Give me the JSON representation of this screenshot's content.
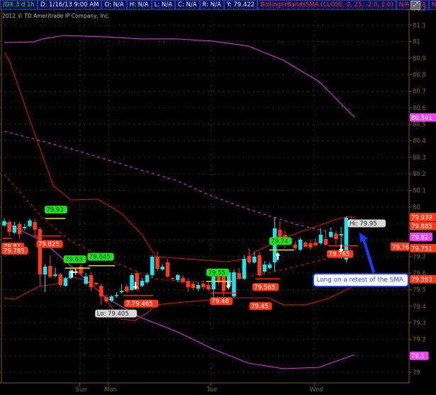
{
  "header": {
    "symbol": "/DX 3 d 1h",
    "date": "D: 1/16/13 9:00 AM",
    "open": "O: N/A",
    "high": "H: N/A",
    "low": "L: N/A",
    "close": "C: N/A",
    "range": "R: N/A",
    "y_value": "Y: 79.422",
    "study": "BollingerBandsSMA (CLOSE, 0, 25, -2.0, 2.0)",
    "study_v1": "N/A",
    "study_v2": "N/A",
    "study_v3": "N...",
    "scale_icon": "autoscale-icon"
  },
  "copyright": "2012 © TD Ameritrade IP Company, Inc.",
  "callout": "Long on a retest of the SMA.",
  "colors": {
    "up": "#22e0e8",
    "down": "#ff3a1a",
    "band": "#c81e0a",
    "outer": "#d23ad6",
    "grid": "#6a5020",
    "axis": "#7a5a20",
    "green_label": "#22dd22",
    "red_label": "#ff3a1a",
    "magenta_label": "#ee44ee",
    "callout_border": "#1a3cff"
  },
  "chart_data": {
    "type": "candlestick",
    "title": "/DX 3 d 1h",
    "ylim": [
      79.0,
      81.2
    ],
    "y_ticks": [
      "81.2",
      "81.1",
      "81",
      "80.9",
      "80.8",
      "80.7",
      "80.6",
      "80.5",
      "80.4",
      "80.3",
      "80.2",
      "80.1",
      "80",
      "79.9",
      "79.8",
      "79.7",
      "79.6",
      "79.5",
      "79.4",
      "79.3",
      "79.2",
      "79.1",
      "79"
    ],
    "x_ticks": [
      {
        "label": "Sun",
        "bar": 14.8
      },
      {
        "label": "Mon",
        "bar": 20.4
      },
      {
        "label": "Tue",
        "bar": 40.5
      },
      {
        "label": "Wed",
        "bar": 60.7
      }
    ],
    "candles": [
      [
        79.888,
        79.931,
        79.879,
        79.914
      ],
      [
        79.909,
        79.922,
        79.823,
        79.849
      ],
      [
        79.845,
        79.909,
        79.836,
        79.888
      ],
      [
        79.896,
        79.909,
        79.806,
        79.836
      ],
      [
        79.871,
        79.896,
        79.858,
        79.879
      ],
      [
        79.884,
        79.931,
        79.875,
        79.918
      ],
      [
        79.909,
        79.931,
        79.815,
        79.862
      ],
      [
        79.866,
        79.879,
        79.523,
        79.592
      ],
      [
        79.592,
        79.656,
        79.485,
        79.639
      ],
      [
        79.643,
        79.708,
        79.57,
        79.579
      ],
      [
        79.583,
        79.635,
        79.575,
        79.592
      ],
      [
        79.592,
        79.6,
        79.515,
        79.528
      ],
      [
        79.523,
        79.579,
        79.519,
        79.57
      ],
      [
        79.57,
        79.63,
        79.562,
        79.613
      ],
      [
        79.609,
        79.63,
        79.588,
        79.609
      ],
      [
        79.639,
        79.652,
        79.588,
        79.596
      ],
      [
        79.536,
        79.6,
        79.528,
        79.579
      ],
      [
        79.588,
        79.605,
        79.493,
        79.515
      ],
      [
        79.541,
        79.545,
        79.528,
        79.532
      ],
      [
        79.523,
        79.536,
        79.408,
        79.459
      ],
      [
        79.455,
        79.472,
        79.416,
        79.429
      ],
      [
        79.433,
        79.468,
        79.425,
        79.459
      ],
      [
        79.463,
        79.485,
        79.45,
        79.468
      ],
      [
        79.485,
        79.532,
        79.476,
        79.493
      ],
      [
        79.519,
        79.536,
        79.48,
        79.489
      ],
      [
        79.498,
        79.6,
        79.493,
        79.588
      ],
      [
        79.6,
        79.613,
        79.493,
        79.502
      ],
      [
        79.523,
        79.57,
        79.515,
        79.553
      ],
      [
        79.545,
        79.6,
        79.536,
        79.588
      ],
      [
        79.588,
        79.708,
        79.57,
        79.699
      ],
      [
        79.699,
        79.729,
        79.609,
        79.626
      ],
      [
        79.622,
        79.656,
        79.613,
        79.639
      ],
      [
        79.665,
        79.686,
        79.57,
        79.579
      ],
      [
        79.57,
        79.575,
        79.562,
        79.566
      ],
      [
        79.558,
        79.596,
        79.545,
        79.588
      ],
      [
        79.57,
        79.588,
        79.536,
        79.545
      ],
      [
        79.553,
        79.57,
        79.485,
        79.515
      ],
      [
        79.536,
        79.553,
        79.498,
        79.51
      ],
      [
        79.506,
        79.545,
        79.493,
        79.528
      ],
      [
        79.536,
        79.553,
        79.502,
        79.515
      ],
      [
        79.528,
        79.545,
        79.493,
        79.502
      ],
      [
        79.502,
        79.6,
        79.438,
        79.579
      ],
      [
        79.579,
        79.6,
        79.528,
        79.545
      ],
      [
        79.583,
        79.592,
        79.459,
        79.493
      ],
      [
        79.523,
        79.622,
        79.502,
        79.605
      ],
      [
        79.459,
        79.622,
        79.45,
        79.605
      ],
      [
        79.6,
        79.63,
        79.558,
        79.566
      ],
      [
        79.566,
        79.708,
        79.558,
        79.686
      ],
      [
        79.703,
        79.751,
        79.656,
        79.665
      ],
      [
        79.665,
        79.729,
        79.656,
        79.699
      ],
      [
        79.708,
        79.729,
        79.579,
        79.588
      ],
      [
        79.609,
        79.673,
        79.6,
        79.652
      ],
      [
        79.63,
        79.665,
        79.622,
        79.652
      ],
      [
        79.665,
        79.939,
        79.609,
        79.871
      ],
      [
        79.862,
        79.914,
        79.793,
        79.815
      ],
      [
        79.832,
        79.858,
        79.751,
        79.785
      ],
      [
        79.781,
        79.802,
        79.772,
        79.789
      ],
      [
        79.772,
        79.793,
        79.742,
        79.751
      ],
      [
        79.742,
        79.815,
        79.733,
        79.802
      ],
      [
        79.785,
        79.793,
        79.751,
        79.759
      ],
      [
        79.781,
        79.802,
        79.742,
        79.755
      ],
      [
        79.785,
        79.811,
        79.759,
        79.768
      ],
      [
        79.781,
        79.871,
        79.772,
        79.832
      ],
      [
        79.806,
        79.858,
        79.764,
        79.772
      ],
      [
        79.819,
        79.875,
        79.811,
        79.849
      ],
      [
        79.836,
        79.858,
        79.772,
        79.806
      ],
      [
        79.828,
        79.879,
        79.686,
        79.836
      ],
      [
        79.682,
        79.944,
        79.665,
        79.935
      ],
      [
        79.926,
        79.939,
        79.879,
        79.884
      ]
    ],
    "candle_format": [
      "open",
      "high",
      "low",
      "close"
    ],
    "series": [
      {
        "name": "upper_outer",
        "style": "magenta",
        "points": [
          [
            0,
            80.994
          ],
          [
            5.8,
            80.998
          ],
          [
            7.5,
            81.016
          ],
          [
            11.7,
            81.037
          ],
          [
            20,
            81.028
          ],
          [
            26.9,
            81.016
          ],
          [
            33.9,
            81.016
          ],
          [
            40.8,
            81.003
          ],
          [
            47.8,
            80.973
          ],
          [
            54.7,
            80.887
          ],
          [
            61.7,
            80.758
          ],
          [
            68.6,
            80.544
          ]
        ]
      },
      {
        "name": "middle_outer",
        "style": "magenta-dashed",
        "points": [
          [
            0,
            80.458
          ],
          [
            13.1,
            80.351
          ],
          [
            20,
            80.287
          ],
          [
            26.9,
            80.222
          ],
          [
            33.9,
            80.158
          ],
          [
            40.8,
            80.064
          ],
          [
            47.8,
            79.987
          ],
          [
            57.5,
            79.892
          ],
          [
            67.2,
            79.824
          ]
        ]
      },
      {
        "name": "lower_outer",
        "style": "magenta",
        "points": [
          [
            0,
            79.909
          ],
          [
            7.5,
            79.793
          ],
          [
            13.1,
            79.643
          ],
          [
            20,
            79.45
          ],
          [
            26.9,
            79.33
          ],
          [
            33.9,
            79.245
          ],
          [
            40.8,
            79.142
          ],
          [
            47.8,
            79.056
          ],
          [
            54.7,
            79.022
          ],
          [
            61.7,
            79.03
          ],
          [
            68.6,
            79.107
          ]
        ]
      },
      {
        "name": "upper_band",
        "style": "red",
        "points": [
          [
            0,
            80.934
          ],
          [
            1,
            80.883
          ],
          [
            5.8,
            80.458
          ],
          [
            9.6,
            80.128
          ],
          [
            13.1,
            80.042
          ],
          [
            18.3,
            80.047
          ],
          [
            22.8,
            79.965
          ],
          [
            26.9,
            79.836
          ],
          [
            29.7,
            79.699
          ],
          [
            43.6,
            79.669
          ],
          [
            47.4,
            79.686
          ],
          [
            49.2,
            79.729
          ],
          [
            55.7,
            79.824
          ],
          [
            62.1,
            79.892
          ],
          [
            64.8,
            79.922
          ],
          [
            67.6,
            79.944
          ],
          [
            69,
            79.931
          ]
        ]
      },
      {
        "name": "sma",
        "style": "red-dashed",
        "points": [
          [
            0,
            80.197
          ],
          [
            7.5,
            79.935
          ],
          [
            13.1,
            79.793
          ],
          [
            20,
            79.686
          ],
          [
            29.3,
            79.566
          ],
          [
            36.7,
            79.545
          ],
          [
            43.6,
            79.558
          ],
          [
            51.9,
            79.601
          ],
          [
            57.5,
            79.643
          ],
          [
            63.1,
            79.686
          ],
          [
            68.6,
            79.759
          ]
        ]
      },
      {
        "name": "lower_band",
        "style": "red",
        "points": [
          [
            0,
            79.45
          ],
          [
            2,
            79.442
          ],
          [
            6.8,
            79.519
          ],
          [
            10.3,
            79.536
          ],
          [
            13.1,
            79.579
          ],
          [
            15.8,
            79.558
          ],
          [
            18.6,
            79.493
          ],
          [
            20.7,
            79.408
          ],
          [
            22.8,
            79.322
          ],
          [
            25.6,
            79.313
          ],
          [
            28.3,
            79.365
          ],
          [
            29.7,
            79.408
          ],
          [
            35.3,
            79.425
          ],
          [
            45,
            79.45
          ],
          [
            51.9,
            79.45
          ],
          [
            54.7,
            79.408
          ],
          [
            58.9,
            79.408
          ],
          [
            63.1,
            79.442
          ],
          [
            65.8,
            79.481
          ],
          [
            68.6,
            79.523
          ]
        ]
      }
    ],
    "annotations": [
      {
        "text": "79.93",
        "kind": "green",
        "bar": 7.9,
        "price": 79.93,
        "line_from": 8,
        "line_to": 12
      },
      {
        "text": "79.63",
        "kind": "green",
        "bar": 11.6,
        "price": 79.63,
        "line_from": 11.9,
        "line_to": 16.8
      },
      {
        "text": "79.645",
        "kind": "green",
        "bar": 16.3,
        "price": 79.645,
        "line_from": 16.5,
        "line_to": 21.7
      },
      {
        "text": "79.55",
        "kind": "green",
        "bar": 39.6,
        "price": 79.55,
        "line_from": 39.6,
        "line_to": 44.6
      },
      {
        "text": "79.74",
        "kind": "green",
        "bar": 51.9,
        "price": 79.74,
        "line_from": 51.9,
        "line_to": 56.8
      },
      {
        "text": "79.81",
        "kind": "red",
        "bar": -0.5,
        "price": 79.81,
        "line_from": -0.3,
        "line_to": 1.5
      },
      {
        "text": "79.785",
        "kind": "red",
        "bar": -0.5,
        "price": 79.785
      },
      {
        "text": "79.825",
        "kind": "red",
        "bar": 6.3,
        "price": 79.825,
        "line_from": 6.1,
        "line_to": 11.1
      },
      {
        "text": "7.79.465",
        "kind": "red",
        "bar": 23.5,
        "price": 79.465,
        "line_from": 23.3,
        "line_to": 29.2
      },
      {
        "text": "79.48",
        "kind": "red",
        "bar": 40.3,
        "price": 79.48,
        "line_from": 40.5,
        "line_to": 45.6
      },
      {
        "text": "79.565",
        "kind": "red",
        "bar": 48.6,
        "price": 79.565,
        "line_from": 49.2,
        "line_to": 54
      },
      {
        "text": "79.45",
        "kind": "red",
        "bar": 48,
        "price": 79.45
      },
      {
        "text": "79.765",
        "kind": "red",
        "bar": 63.2,
        "price": 79.765,
        "line_from": 63.5,
        "line_to": 69.3
      },
      {
        "text": "Lo: 79.405",
        "kind": "grey",
        "bar": 17.8,
        "price": 79.405
      },
      {
        "text": "Hi: 79.95",
        "kind": "grey",
        "bar": 67.3,
        "price": 79.95
      }
    ],
    "arrows": [
      {
        "dir": "up",
        "bar": 13.3,
        "price": 79.6
      },
      {
        "dir": "down",
        "bar": 25.7,
        "price": 79.52
      },
      {
        "dir": "down",
        "bar": 43.9,
        "price": 79.525
      },
      {
        "dir": "up",
        "bar": 53.6,
        "price": 79.705
      },
      {
        "dir": "down",
        "bar": 66,
        "price": 79.745
      }
    ],
    "price_labels": [
      {
        "text": "80.541",
        "kind": "magenta",
        "price": 80.541
      },
      {
        "text": "79.939",
        "kind": "red",
        "price": 79.939
      },
      {
        "text": "79.885",
        "kind": "red",
        "price": 79.885
      },
      {
        "text": "79.82",
        "kind": "magenta",
        "price": 79.82
      },
      {
        "text": "79.751",
        "kind": "red",
        "price": 79.751
      },
      {
        "text": "79.563",
        "kind": "red",
        "price": 79.563
      },
      {
        "text": "79.1",
        "kind": "magenta",
        "price": 79.1
      },
      {
        "text": "79.76",
        "kind": "red-inset",
        "price": 79.76
      }
    ]
  }
}
